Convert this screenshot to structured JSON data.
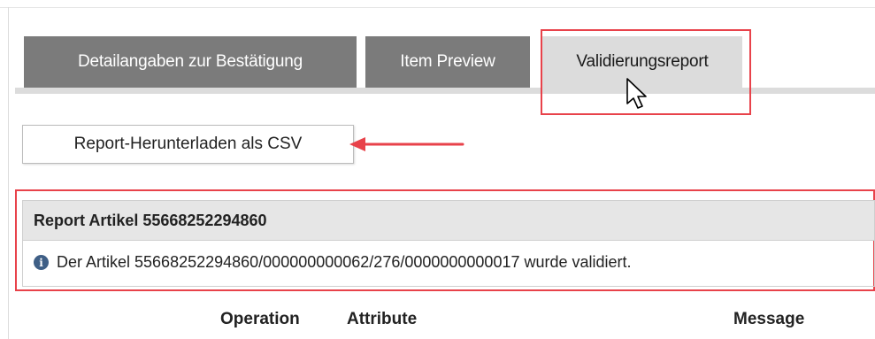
{
  "tabs": [
    {
      "label": "Detailangaben zur Bestätigung",
      "state": "inactive"
    },
    {
      "label": "Item Preview",
      "state": "inactive"
    },
    {
      "label": "Validierungsreport",
      "state": "active"
    }
  ],
  "toolbar": {
    "csv_button_label": "Report-Herunterladen als CSV"
  },
  "report": {
    "title": "Report Artikel 55668252294860",
    "message_icon": "info-icon",
    "message": "Der Artikel 55668252294860/000000000062/276/0000000000017 wurde validiert."
  },
  "table": {
    "columns": [
      "Operation",
      "Attribute",
      "Message"
    ]
  },
  "colors": {
    "tab_inactive": "#7b7b7b",
    "tab_active": "#dcdcdc",
    "annotation_red": "#e8424a",
    "info_icon": "#3f5f86"
  }
}
